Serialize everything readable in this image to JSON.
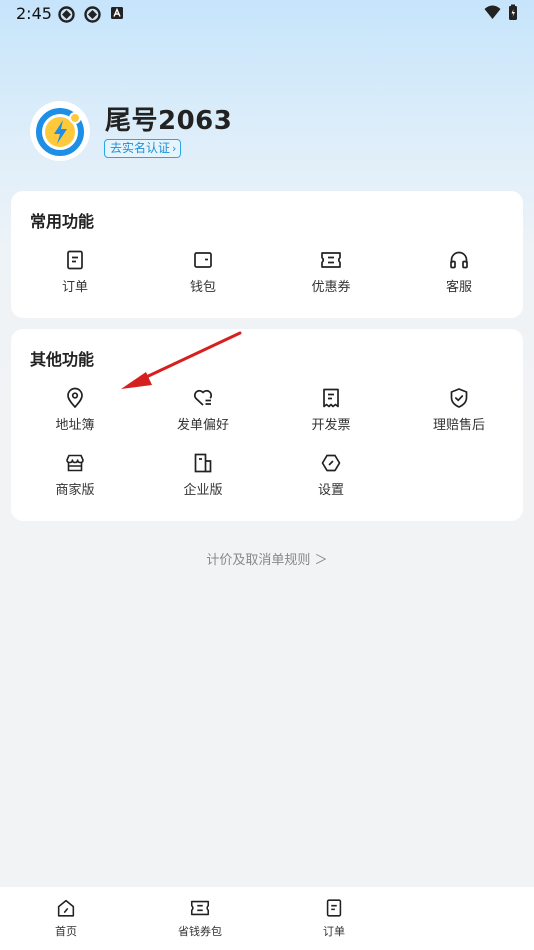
{
  "status_bar": {
    "time": "2:45"
  },
  "profile": {
    "username": "尾号2063",
    "verify_label": "去实名认证",
    "verify_chevron": "›"
  },
  "common_section": {
    "title": "常用功能",
    "items": [
      {
        "label": "订单",
        "icon": "order-icon"
      },
      {
        "label": "钱包",
        "icon": "wallet-icon"
      },
      {
        "label": "优惠券",
        "icon": "coupon-icon"
      },
      {
        "label": "客服",
        "icon": "headset-icon"
      }
    ]
  },
  "other_section": {
    "title": "其他功能",
    "items": [
      {
        "label": "地址簿",
        "icon": "location-pin-icon"
      },
      {
        "label": "发单偏好",
        "icon": "heart-list-icon"
      },
      {
        "label": "开发票",
        "icon": "invoice-icon"
      },
      {
        "label": "理赔售后",
        "icon": "shield-check-icon"
      },
      {
        "label": "商家版",
        "icon": "store-icon"
      },
      {
        "label": "企业版",
        "icon": "building-icon"
      },
      {
        "label": "设置",
        "icon": "settings-icon"
      }
    ]
  },
  "rules_link": {
    "label": "计价及取消单规则 ＞"
  },
  "bottom_nav": {
    "items": [
      {
        "label": "首页",
        "icon": "home-icon"
      },
      {
        "label": "省钱券包",
        "icon": "coupon-icon"
      },
      {
        "label": "订单",
        "icon": "order-icon"
      }
    ]
  },
  "colors": {
    "accent": "#1f8fd6",
    "annotation_arrow": "#d62020",
    "logo_blue": "#1e8fe6",
    "logo_yellow": "#ffc93c"
  }
}
